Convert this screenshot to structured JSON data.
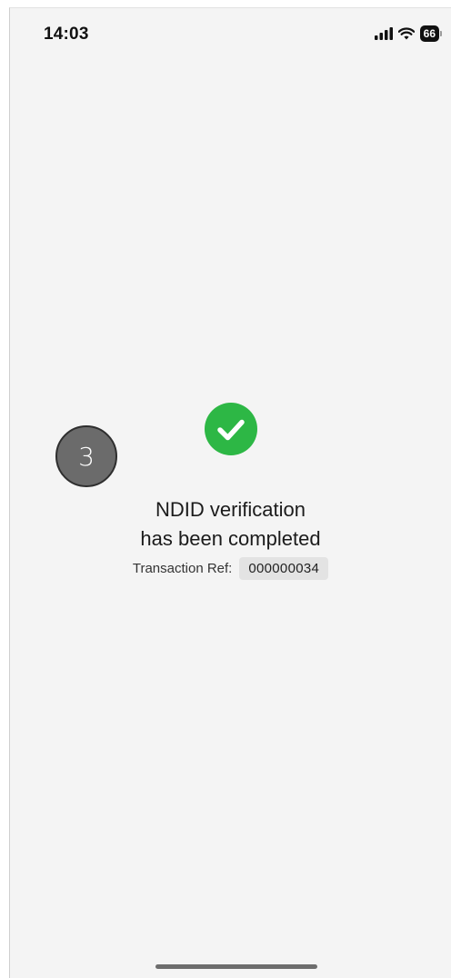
{
  "status_bar": {
    "time": "14:03",
    "battery": "66",
    "icons": [
      "signal-icon",
      "wifi-icon",
      "battery-icon"
    ]
  },
  "success": {
    "icon": "check-circle-icon",
    "color": "#2db745",
    "title_line1": "NDID verification",
    "title_line2": "has been completed"
  },
  "transaction": {
    "label": "Transaction Ref:",
    "value": "000000034"
  },
  "step_badge": {
    "number": "3"
  }
}
